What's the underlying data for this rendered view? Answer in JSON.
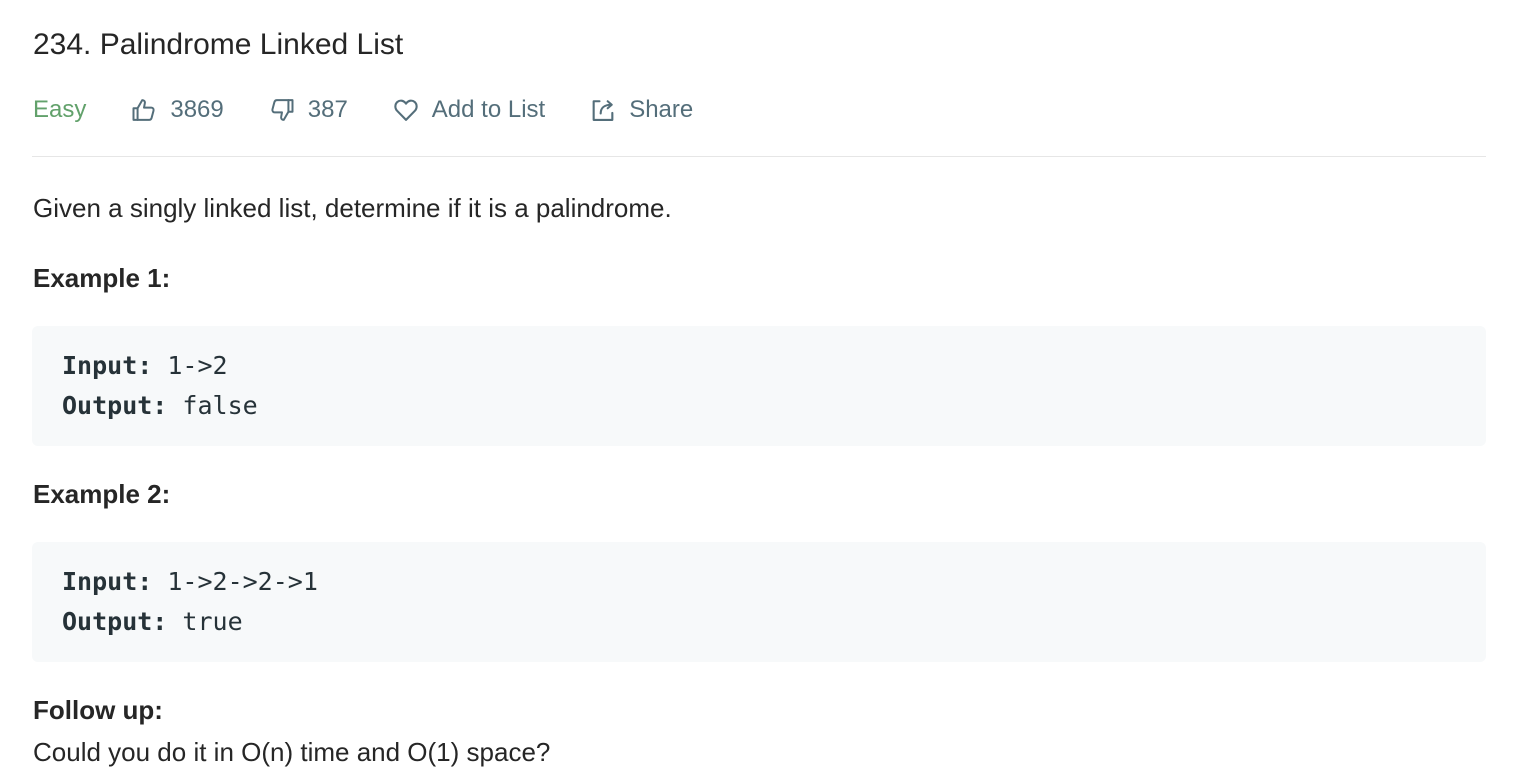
{
  "problem": {
    "title": "234. Palindrome Linked List",
    "difficulty": "Easy",
    "likes": "3869",
    "dislikes": "387",
    "add_to_list_label": "Add to List",
    "share_label": "Share"
  },
  "description": {
    "intro": "Given a singly linked list, determine if it is a palindrome.",
    "examples": [
      {
        "heading": "Example 1:",
        "input_label": "Input:",
        "input_value": " 1->2",
        "output_label": "Output:",
        "output_value": " false"
      },
      {
        "heading": "Example 2:",
        "input_label": "Input:",
        "input_value": " 1->2->2->1",
        "output_label": "Output:",
        "output_value": " true"
      }
    ],
    "follow_up_heading": "Follow up:",
    "follow_up_text": "Could you do it in O(n) time and O(1) space?"
  },
  "colors": {
    "difficulty_easy": "#62a16b",
    "meta_text": "#546e7a",
    "code_background": "#f7f9fa"
  },
  "icons": {
    "like": "thumbs-up-icon",
    "dislike": "thumbs-down-icon",
    "favorite": "heart-icon",
    "share": "share-icon"
  }
}
